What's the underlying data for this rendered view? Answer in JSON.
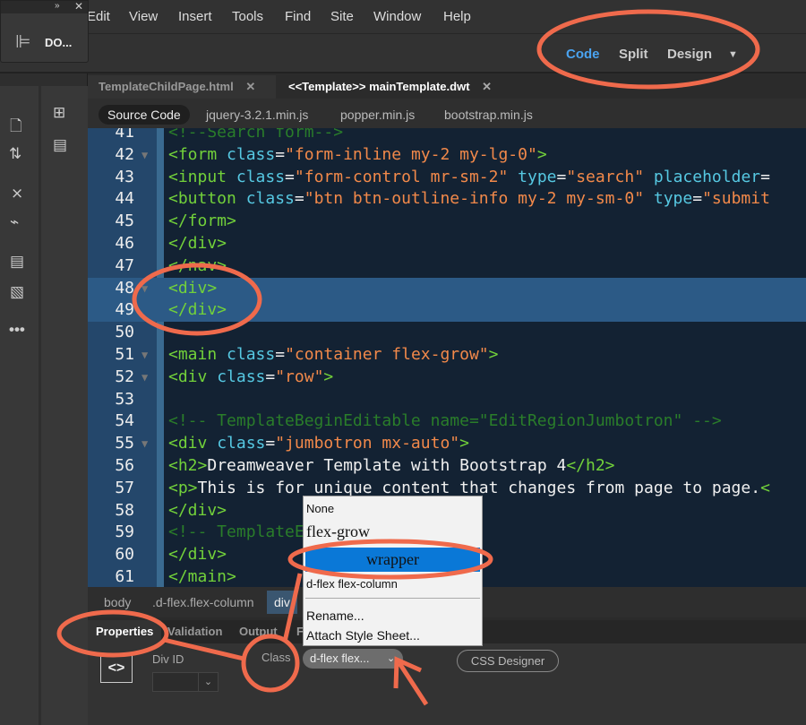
{
  "menu": [
    "Edit",
    "View",
    "Insert",
    "Tools",
    "Find",
    "Site",
    "Window",
    "Help"
  ],
  "floating_panel": {
    "title": "DO...",
    "expand": "»",
    "close": "✕"
  },
  "views": {
    "code": "Code",
    "split": "Split",
    "design": "Design",
    "accent": "#4aa3f0"
  },
  "tabs": [
    {
      "label": "TemplateChildPage.html",
      "close": "✕"
    },
    {
      "label": "<<Template>> mainTemplate.dwt",
      "close": "✕"
    }
  ],
  "subtabs": [
    "Source Code",
    "jquery-3.2.1.min.js",
    "popper.min.js",
    "bootstrap.min.js"
  ],
  "code_lines": [
    {
      "n": "41",
      "fold": false,
      "seg": [
        [
          "com",
          "<!--Search form-->"
        ]
      ]
    },
    {
      "n": "42",
      "fold": true,
      "seg": [
        [
          "tag",
          "<form "
        ],
        [
          "attr",
          "class"
        ],
        [
          "txt",
          "="
        ],
        [
          "str",
          "\"form-inline my-2 my-lg-0\""
        ],
        [
          "tag",
          ">"
        ]
      ]
    },
    {
      "n": "43",
      "fold": false,
      "seg": [
        [
          "tag",
          "<input "
        ],
        [
          "attr",
          "class"
        ],
        [
          "txt",
          "="
        ],
        [
          "str",
          "\"form-control mr-sm-2\""
        ],
        [
          "txt",
          " "
        ],
        [
          "attr",
          "type"
        ],
        [
          "txt",
          "="
        ],
        [
          "str",
          "\"search\""
        ],
        [
          "txt",
          " "
        ],
        [
          "attr",
          "placeholder"
        ],
        [
          "txt",
          "="
        ]
      ]
    },
    {
      "n": "44",
      "fold": false,
      "seg": [
        [
          "tag",
          "<button "
        ],
        [
          "attr",
          "class"
        ],
        [
          "txt",
          "="
        ],
        [
          "str",
          "\"btn btn-outline-info my-2 my-sm-0\""
        ],
        [
          "txt",
          " "
        ],
        [
          "attr",
          "type"
        ],
        [
          "txt",
          "="
        ],
        [
          "str",
          "\"submit"
        ]
      ]
    },
    {
      "n": "45",
      "fold": false,
      "seg": [
        [
          "tag",
          "</form>"
        ]
      ]
    },
    {
      "n": "46",
      "fold": false,
      "seg": [
        [
          "tag",
          "</div>"
        ]
      ]
    },
    {
      "n": "47",
      "fold": false,
      "seg": [
        [
          "tag",
          "</nav>"
        ]
      ]
    },
    {
      "n": "48",
      "fold": true,
      "sel": true,
      "seg": [
        [
          "tag",
          "<div>"
        ]
      ]
    },
    {
      "n": "49",
      "fold": false,
      "sel": true,
      "seg": [
        [
          "tag",
          "</div>"
        ]
      ]
    },
    {
      "n": "50",
      "fold": false,
      "seg": []
    },
    {
      "n": "51",
      "fold": true,
      "seg": [
        [
          "tag",
          "<main "
        ],
        [
          "attr",
          "class"
        ],
        [
          "txt",
          "="
        ],
        [
          "str",
          "\"container flex-grow\""
        ],
        [
          "tag",
          ">"
        ]
      ]
    },
    {
      "n": "52",
      "fold": true,
      "seg": [
        [
          "tag",
          "<div "
        ],
        [
          "attr",
          "class"
        ],
        [
          "txt",
          "="
        ],
        [
          "str",
          "\"row\""
        ],
        [
          "tag",
          ">"
        ]
      ]
    },
    {
      "n": "53",
      "fold": false,
      "seg": []
    },
    {
      "n": "54",
      "fold": false,
      "seg": [
        [
          "com",
          "<!-- TemplateBeginEditable name=\"EditRegionJumbotron\" -->"
        ]
      ]
    },
    {
      "n": "55",
      "fold": true,
      "seg": [
        [
          "tag",
          "<div "
        ],
        [
          "attr",
          "class"
        ],
        [
          "txt",
          "="
        ],
        [
          "str",
          "\"jumbotron mx-auto\""
        ],
        [
          "tag",
          ">"
        ]
      ]
    },
    {
      "n": "56",
      "fold": false,
      "seg": [
        [
          "tag",
          "<h2>"
        ],
        [
          "txt",
          "Dreamweaver Template with Bootstrap 4"
        ],
        [
          "tag",
          "</h2>"
        ]
      ]
    },
    {
      "n": "57",
      "fold": false,
      "seg": [
        [
          "tag",
          "<p>"
        ],
        [
          "txt",
          "This is for unique content that changes from page to page."
        ],
        [
          "tag",
          "<"
        ]
      ]
    },
    {
      "n": "58",
      "fold": false,
      "seg": [
        [
          "tag",
          "</div>"
        ]
      ]
    },
    {
      "n": "59",
      "fold": false,
      "seg": [
        [
          "com",
          "<!-- TemplateEndEditable -->"
        ]
      ]
    },
    {
      "n": "60",
      "fold": false,
      "seg": [
        [
          "tag",
          "</div>"
        ]
      ]
    },
    {
      "n": "61",
      "fold": false,
      "seg": [
        [
          "tag",
          "</main>"
        ]
      ]
    }
  ],
  "breadcrumb": [
    "body",
    ".d-flex.flex-column",
    "div"
  ],
  "panel_tabs": [
    "Properties",
    "Validation",
    "Output",
    "F"
  ],
  "properties": {
    "div_id_label": "Div ID",
    "div_id_value": "",
    "class_label": "Class",
    "class_value": "d-flex flex...",
    "css_designer": "CSS Designer"
  },
  "class_dropdown": {
    "items": [
      "None",
      "flex-grow",
      "wrapper",
      "d-flex flex-column"
    ],
    "selected": "wrapper",
    "actions": [
      "Rename...",
      "Attach Style Sheet..."
    ],
    "selected_color": "#0a78d7"
  },
  "annotation_color": "#ef6a4c"
}
